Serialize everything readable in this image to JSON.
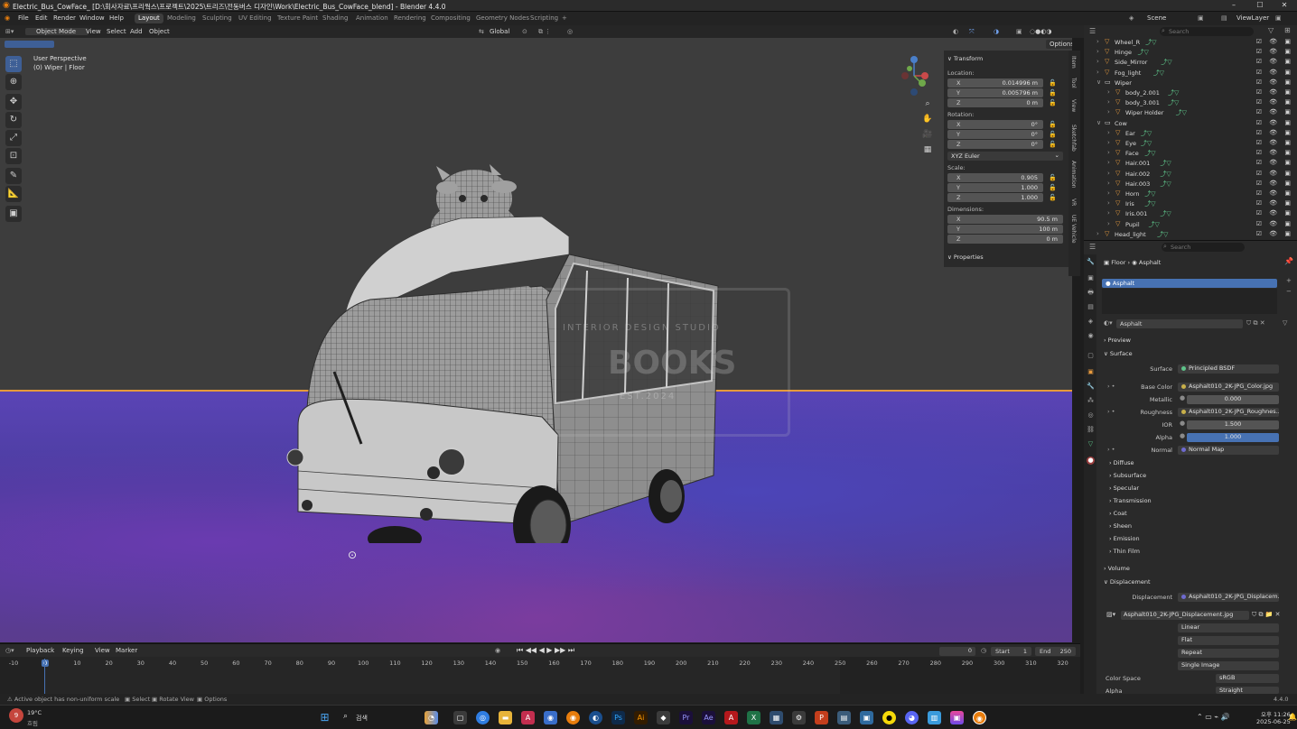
{
  "window": {
    "title": "Electric_Bus_CowFace_ [D:\\회사자료\\프리웍스\\프로젝트\\2025\\트리즈\\전동버스 디자인\\Work\\Electric_Bus_CowFace_blend] - Blender 4.4.0"
  },
  "menu": {
    "items": [
      "File",
      "Edit",
      "Render",
      "Window",
      "Help"
    ]
  },
  "workspaces": [
    "Layout",
    "Modeling",
    "Sculpting",
    "UV Editing",
    "Texture Paint",
    "Shading",
    "Animation",
    "Rendering",
    "Compositing",
    "Geometry Nodes",
    "Scripting"
  ],
  "scene": {
    "name": "Scene",
    "view_layer": "ViewLayer"
  },
  "viewport_header": {
    "mode": "Object Mode",
    "view": "View",
    "select": "Select",
    "add": "Add",
    "object": "Object",
    "orientation": "Global",
    "options": "Options"
  },
  "viewport": {
    "perspective": "User Perspective",
    "context": "(0) Wiper | Floor",
    "watermark_top": "INTERIOR DESIGN STUDIO",
    "watermark_mid": "BOOKS",
    "watermark_bottom": "EST.2024"
  },
  "npanel": {
    "transform": "Transform",
    "location_label": "Location:",
    "location": {
      "x": "0.014996 m",
      "y": "0.005796 m",
      "z": "0 m"
    },
    "rotation_label": "Rotation:",
    "rotation": {
      "x": "0°",
      "y": "0°",
      "z": "0°"
    },
    "rotation_mode": "XYZ Euler",
    "scale_label": "Scale:",
    "scale": {
      "x": "0.905",
      "y": "1.000",
      "z": "1.000"
    },
    "dimensions_label": "Dimensions:",
    "dimensions": {
      "x": "90.5 m",
      "y": "100 m",
      "z": "0 m"
    },
    "properties": "Properties",
    "axes": {
      "x": "X",
      "y": "Y",
      "z": "Z"
    }
  },
  "side_tabs": [
    "Item",
    "Tool",
    "View",
    "Sketchfab",
    "Animation",
    "VR",
    "UE Vehicle"
  ],
  "outliner": {
    "search_placeholder": "Search",
    "rows": [
      {
        "name": "Wheel_R",
        "indent": 1
      },
      {
        "name": "Hinge",
        "indent": 1
      },
      {
        "name": "Side_Mirror",
        "indent": 1
      },
      {
        "name": "Fog_light",
        "indent": 1
      },
      {
        "name": "Wiper",
        "indent": 1
      },
      {
        "name": "body_2.001",
        "indent": 2
      },
      {
        "name": "body_3.001",
        "indent": 2
      },
      {
        "name": "Wiper Holder",
        "indent": 2
      },
      {
        "name": "Cow",
        "indent": 1
      },
      {
        "name": "Ear",
        "indent": 2
      },
      {
        "name": "Eye",
        "indent": 2
      },
      {
        "name": "Face",
        "indent": 2
      },
      {
        "name": "Hair.001",
        "indent": 2
      },
      {
        "name": "Hair.002",
        "indent": 2
      },
      {
        "name": "Hair.003",
        "indent": 2
      },
      {
        "name": "Horn",
        "indent": 2
      },
      {
        "name": "Iris",
        "indent": 2
      },
      {
        "name": "Iris.001",
        "indent": 2
      },
      {
        "name": "Pupil",
        "indent": 2
      },
      {
        "name": "Head_light",
        "indent": 1
      }
    ]
  },
  "properties": {
    "search_placeholder": "Search",
    "breadcrumb": {
      "object": "Floor",
      "material": "Asphalt"
    },
    "slot": "Asphalt",
    "material_name": "Asphalt",
    "preview": "Preview",
    "surface_section": "Surface",
    "surface": {
      "label": "Surface",
      "value": "Principled BSDF"
    },
    "base_color": {
      "label": "Base Color",
      "value": "Asphalt010_2K-JPG_Color.jpg"
    },
    "metallic": {
      "label": "Metallic",
      "value": "0.000"
    },
    "roughness": {
      "label": "Roughness",
      "value": "Asphalt010_2K-JPG_Roughnes..."
    },
    "ior": {
      "label": "IOR",
      "value": "1.500"
    },
    "alpha": {
      "label": "Alpha",
      "value": "1.000"
    },
    "normal": {
      "label": "Normal",
      "value": "Normal Map"
    },
    "subsections": [
      "Diffuse",
      "Subsurface",
      "Specular",
      "Transmission",
      "Coat",
      "Sheen",
      "Emission",
      "Thin Film"
    ],
    "volume": "Volume",
    "displacement_section": "Displacement",
    "displacement": {
      "label": "Displacement",
      "value": "Asphalt010_2K-JPG_Displacem..."
    },
    "image_name": "Asphalt010_2K-JPG_Displacement.jpg",
    "interpolation": "Linear",
    "projection": "Flat",
    "extension": "Repeat",
    "source": "Single Image",
    "color_space": {
      "label": "Color Space",
      "value": "sRGB"
    },
    "alpha_mode": {
      "label": "Alpha",
      "value": "Straight"
    }
  },
  "timeline": {
    "playback": "Playback",
    "keying": "Keying",
    "view": "View",
    "marker": "Marker",
    "current_frame": "0",
    "start_label": "Start",
    "start": "1",
    "end_label": "End",
    "end": "250",
    "ticks": [
      "-10",
      "0",
      "10",
      "20",
      "30",
      "40",
      "50",
      "60",
      "70",
      "80",
      "90",
      "100",
      "110",
      "120",
      "130",
      "140",
      "150",
      "160",
      "170",
      "180",
      "190",
      "200",
      "210",
      "220",
      "230",
      "240",
      "250",
      "260",
      "270",
      "280",
      "290",
      "300",
      "310",
      "320"
    ]
  },
  "statusbar": {
    "warning": "Active object has non-uniform scale",
    "select": "Select",
    "rotate": "Rotate View",
    "options": "Options",
    "version": "4.4.0"
  },
  "taskbar": {
    "weather_temp": "19°C",
    "weather_desc": "흐림",
    "badge": "9",
    "search": "검색",
    "time_period": "오후",
    "time": "11:26",
    "date": "2025-06-25"
  }
}
